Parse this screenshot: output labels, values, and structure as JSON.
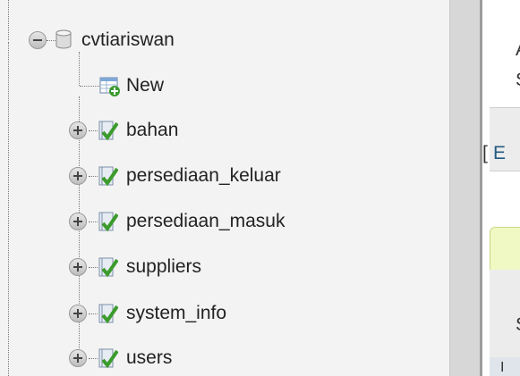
{
  "tree": {
    "database": {
      "name": "cvtiariswan",
      "icon": "database-icon",
      "expander": "minus"
    },
    "new_item": {
      "label": "New",
      "icon": "new-table-icon"
    },
    "tables": [
      {
        "label": "bahan",
        "icon": "table-icon",
        "expander": "plus"
      },
      {
        "label": "persediaan_keluar",
        "icon": "table-icon",
        "expander": "plus"
      },
      {
        "label": "persediaan_masuk",
        "icon": "table-icon",
        "expander": "plus"
      },
      {
        "label": "suppliers",
        "icon": "table-icon",
        "expander": "plus"
      },
      {
        "label": "system_info",
        "icon": "table-icon",
        "expander": "plus"
      },
      {
        "label": "users",
        "icon": "table-icon",
        "expander": "plus"
      }
    ]
  },
  "content_fragments": {
    "top_text": "A",
    "second_text": "S",
    "bracket_link_prefix": "[",
    "bracket_link_text": "E",
    "lower_text": "S",
    "bottom_text": "I"
  },
  "colors": {
    "tree_background": "#f3f3f3",
    "splitter": "#d7d7d7",
    "link": "#235a81",
    "highlight_box": "#f0f9c4"
  }
}
